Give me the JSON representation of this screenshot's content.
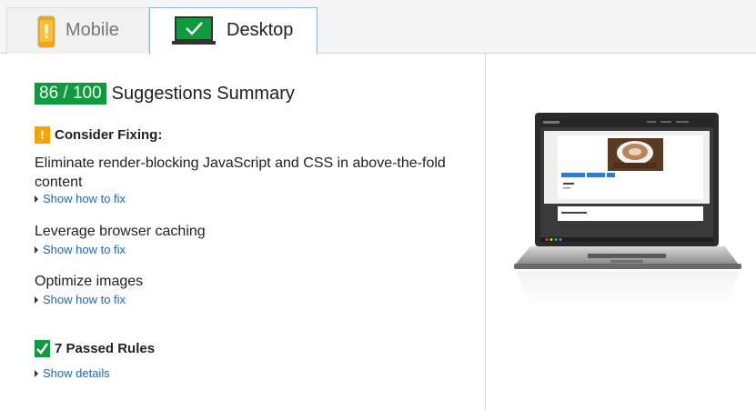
{
  "tabs": [
    {
      "label": "Mobile",
      "active": false
    },
    {
      "label": "Desktop",
      "active": true
    }
  ],
  "score": {
    "value": "86 / 100",
    "title": "Suggestions Summary",
    "color": "#109a3e"
  },
  "consider": {
    "heading": "Consider Fixing:",
    "icon": "!",
    "items": [
      {
        "title": "Eliminate render-blocking JavaScript and CSS in above-the-fold content",
        "link": "Show how to fix"
      },
      {
        "title": "Leverage browser caching",
        "link": "Show how to fix"
      },
      {
        "title": "Optimize images",
        "link": "Show how to fix"
      }
    ]
  },
  "passed": {
    "heading": "7 Passed Rules",
    "link": "Show details"
  },
  "preview": {
    "device": "laptop-icon"
  },
  "colors": {
    "warning": "#f4a300",
    "pass": "#109a3e",
    "link": "#2168b5"
  }
}
